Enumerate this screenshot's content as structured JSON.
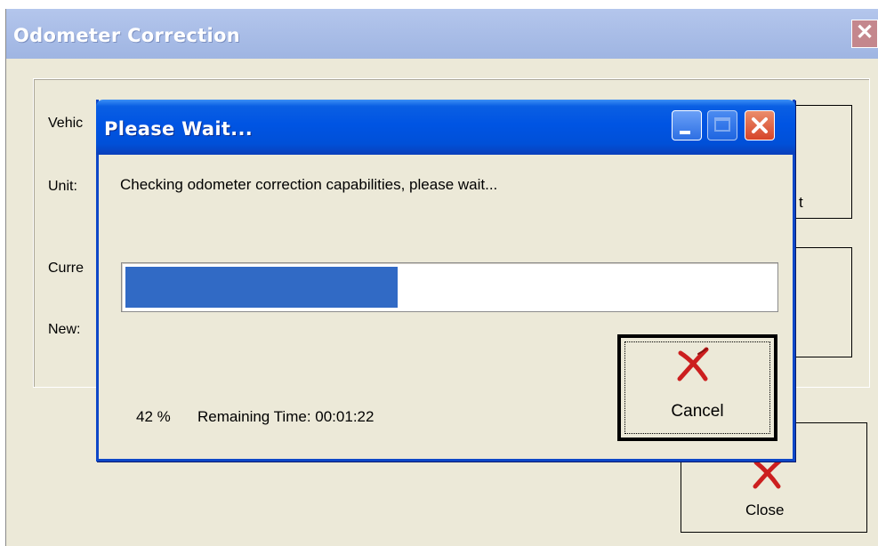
{
  "background_window": {
    "title": "Odometer Correction",
    "close_glyph": "✕",
    "labels": {
      "vehicle": "Vehic",
      "unit": "Unit:",
      "current": "Curre",
      "new": "New:"
    },
    "right_button_fragment": "t",
    "close_button_label": "Close"
  },
  "dialog": {
    "title": "Please Wait...",
    "message": "Checking odometer correction capabilities, please wait...",
    "progress_fraction": 0.42,
    "percent_text": "42 %",
    "remaining_text": "Remaining Time: 00:01:22",
    "cancel_label": "Cancel"
  },
  "icons": {
    "cancel": "red-x-icon",
    "minimize": "minimize-icon",
    "maximize": "maximize-icon",
    "close": "close-icon"
  },
  "colors": {
    "titlebar_active": "#0054e3",
    "progress_fill": "#316ac5",
    "window_face": "#ece9d8",
    "x_red": "#cc1f1f"
  }
}
